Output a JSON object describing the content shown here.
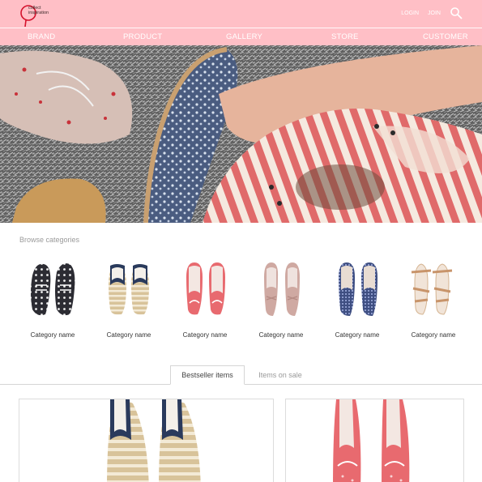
{
  "header": {
    "logo_line1": "collect",
    "logo_line2": "inspiration",
    "login_label": "LOGIN",
    "join_label": "JOIN",
    "search_icon": "search-icon",
    "background": "#ffbfc6"
  },
  "nav": {
    "items": [
      {
        "label": "BRAND"
      },
      {
        "label": "PRODUCT"
      },
      {
        "label": "GALLERY"
      },
      {
        "label": "STORE"
      },
      {
        "label": "CUSTOMER"
      }
    ]
  },
  "hero": {
    "image": "photo of sneakers and striped shoes on shaggy rug"
  },
  "categories": {
    "title": "Browse categories",
    "items": [
      {
        "label": "Category name",
        "shoe": "polka-dot-sneakers"
      },
      {
        "label": "Category name",
        "shoe": "striped-espadrilles"
      },
      {
        "label": "Category name",
        "shoe": "pink-ballet-flats"
      },
      {
        "label": "Category name",
        "shoe": "nude-bow-flats"
      },
      {
        "label": "Category name",
        "shoe": "blue-tweed-loafers"
      },
      {
        "label": "Category name",
        "shoe": "nude-strap-sandals"
      }
    ]
  },
  "tabs": {
    "active": "Bestseller items",
    "inactive": "Items on sale"
  },
  "products": [
    {
      "shoe": "striped-espadrilles"
    },
    {
      "shoe": "pink-ballet-flats"
    }
  ]
}
